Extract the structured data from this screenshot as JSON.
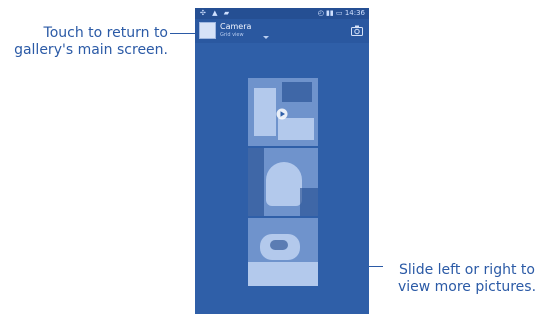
{
  "callouts": {
    "left": "Touch to return to gallery's main screen.",
    "right": "Slide left or right to view more pictures."
  },
  "phone": {
    "status": {
      "left_icons": "✣ ▲ ▰",
      "time": "14:36",
      "signal_icons": "◴ ▮▮ ▭"
    },
    "actionbar": {
      "title": "Camera",
      "subtitle": "Grid view"
    },
    "thumbnails": [
      {
        "type": "video-thumbnail"
      },
      {
        "type": "photo-thumbnail"
      },
      {
        "type": "photo-thumbnail"
      }
    ]
  }
}
